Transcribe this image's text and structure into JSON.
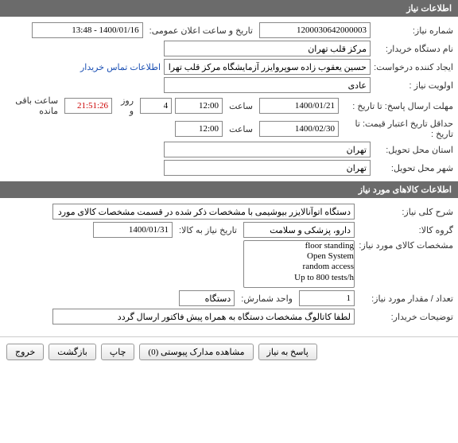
{
  "section1": {
    "title": "اطلاعات نیاز"
  },
  "need": {
    "number_label": "شماره نیاز:",
    "number": "1200030642000003",
    "announce_label": "تاریخ و ساعت اعلان عمومی:",
    "announce": "1400/01/16 - 13:48",
    "buyer_label": "نام دستگاه خریدار:",
    "buyer": "مرکز قلب تهران",
    "creator_label": "ایجاد کننده درخواست:",
    "creator": "حسین یعقوب زاده سوپروایزر آزمایشگاه مرکز قلب تهران",
    "contact_link": "اطلاعات تماس خریدار",
    "priority_label": "اولویت نیاز :",
    "priority": "عادی",
    "deadline_label": "مهلت ارسال پاسخ:",
    "to_date_label": "تا تاریخ :",
    "deadline_date": "1400/01/21",
    "time_label": "ساعت",
    "deadline_time": "12:00",
    "days_value": "4",
    "days_label": "روز و",
    "remain_time": "21:51:26",
    "remain_label": "ساعت باقی مانده",
    "min_date_label": "حداقل تاریخ اعتبار قیمت:",
    "min_date": "1400/02/30",
    "min_time": "12:00",
    "province_label": "استان محل تحویل:",
    "province": "تهران",
    "city_label": "شهر محل تحویل:",
    "city": "تهران"
  },
  "section2": {
    "title": "اطلاعات کالاهای مورد نیاز"
  },
  "goods": {
    "desc_label": "شرح کلی نیاز:",
    "desc": "دستگاه اتوآنالایزر بیوشیمی با مشخصات ذکر شده در قسمت مشخصات کالای مورد نیاز",
    "group_label": "گروه کالا:",
    "group": "دارو، پزشکی و سلامت",
    "need_by_label": "تاریخ نیاز به کالا:",
    "need_by": "1400/01/31",
    "spec_label": "مشخصات کالای مورد نیاز:",
    "spec_options": [
      "floor standing",
      "Open System",
      "random access",
      "Up to 800 tests/h"
    ],
    "qty_label": "تعداد / مقدار مورد نیاز:",
    "qty": "1",
    "unit_label": "واحد شمارش:",
    "unit": "دستگاه",
    "notes_label": "توضیحات خریدار:",
    "notes": "لطفا کاتالوگ مشخصات دستگاه به همراه پیش فاکتور ارسال گردد"
  },
  "footer": {
    "respond": "پاسخ به نیاز",
    "attachments": "مشاهده مدارک پیوستی  (0)",
    "print": "چاپ",
    "back": "بازگشت",
    "exit": "خروج"
  }
}
